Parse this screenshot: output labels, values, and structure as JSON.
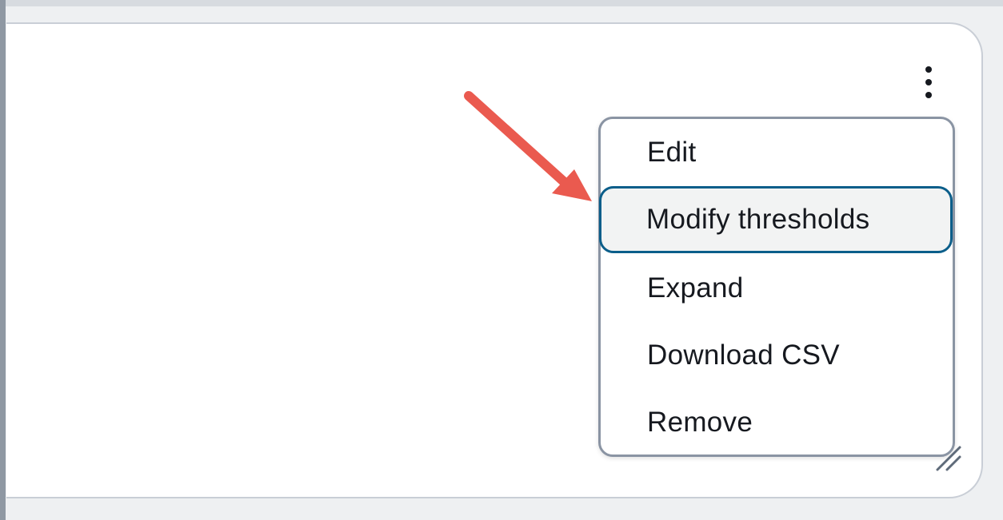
{
  "menu": {
    "items": [
      {
        "label": "Edit"
      },
      {
        "label": "Modify thresholds"
      },
      {
        "label": "Expand"
      },
      {
        "label": "Download CSV"
      },
      {
        "label": "Remove"
      }
    ],
    "highlighted_index": 1
  },
  "icons": {
    "kebab": "vertical-ellipsis-icon",
    "resize": "resize-handle-icon",
    "arrow": "annotation-arrow"
  },
  "colors": {
    "highlight_border": "#0b5e8a",
    "arrow": "#ea5a4f",
    "menu_border": "#8a94a3"
  }
}
